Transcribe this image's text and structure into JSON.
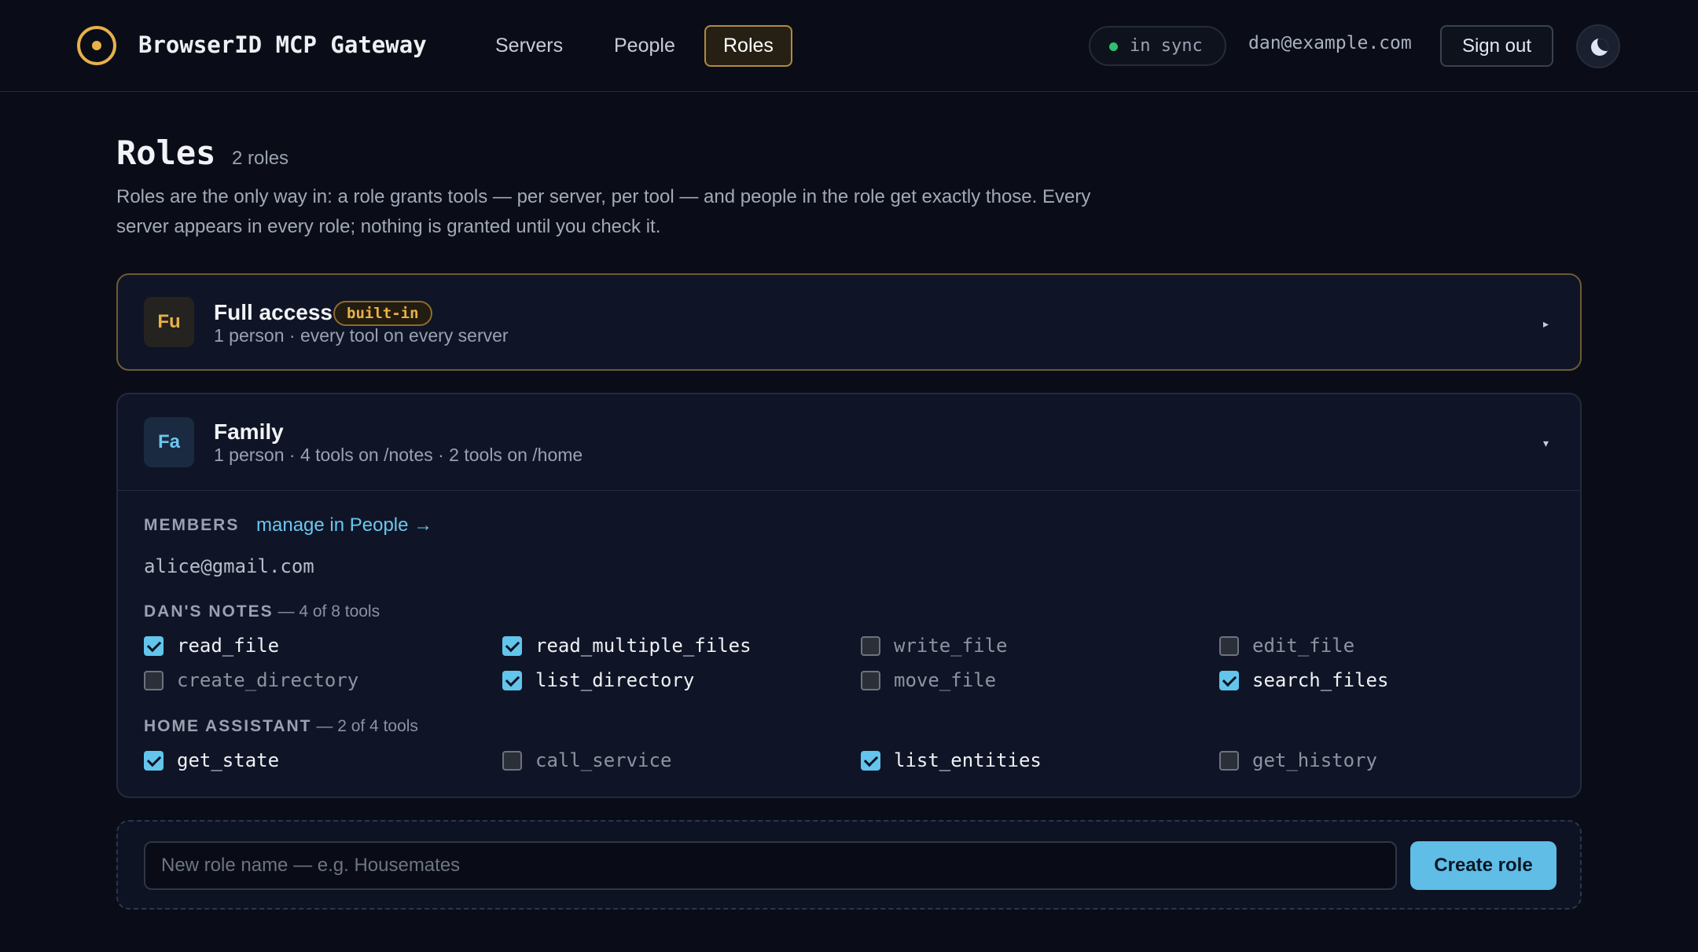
{
  "header": {
    "app_title": "BrowserID MCP Gateway",
    "logo_icon": "gateway-logo-icon",
    "nav": [
      {
        "label": "Servers",
        "active": false
      },
      {
        "label": "People",
        "active": false
      },
      {
        "label": "Roles",
        "active": true
      }
    ],
    "sync_status": "in sync",
    "sync_color": "#2fbf71",
    "user_email": "dan@example.com",
    "sign_out_label": "Sign out",
    "theme_icon": "moon-icon"
  },
  "page": {
    "title": "Roles",
    "count": "2 roles",
    "description": "Roles are the only way in: a role grants tools — per server, per tool — and people in the role get exactly those. Every server appears in every role; nothing is granted until you check it."
  },
  "roles": [
    {
      "initials": "Fu",
      "name": "Full access",
      "badge": "built-in",
      "summary": "1 person · every tool on every server",
      "expanded": false
    },
    {
      "initials": "Fa",
      "name": "Family",
      "summary": "1 person · 4 tools on /notes · 2 tools on /home",
      "expanded": true,
      "members_label": "MEMBERS",
      "manage_link": "manage in People →",
      "members": [
        "alice@gmail.com"
      ],
      "servers": [
        {
          "name": "DAN'S NOTES",
          "count": "— 4 of 8 tools",
          "tools": [
            {
              "name": "read_file",
              "checked": true
            },
            {
              "name": "read_multiple_files",
              "checked": true
            },
            {
              "name": "write_file",
              "checked": false
            },
            {
              "name": "edit_file",
              "checked": false
            },
            {
              "name": "create_directory",
              "checked": false
            },
            {
              "name": "list_directory",
              "checked": true
            },
            {
              "name": "move_file",
              "checked": false
            },
            {
              "name": "search_files",
              "checked": true
            }
          ]
        },
        {
          "name": "HOME ASSISTANT",
          "count": "— 2 of 4 tools",
          "tools": [
            {
              "name": "get_state",
              "checked": true
            },
            {
              "name": "call_service",
              "checked": false
            },
            {
              "name": "list_entities",
              "checked": true
            },
            {
              "name": "get_history",
              "checked": false
            }
          ]
        }
      ]
    }
  ],
  "create": {
    "placeholder": "New role name — e.g. Housemates",
    "value": "",
    "button_label": "Create role"
  },
  "colors": {
    "accent_gold": "#e8b04a",
    "accent_blue": "#5fbde6",
    "background": "#0a0d17"
  }
}
